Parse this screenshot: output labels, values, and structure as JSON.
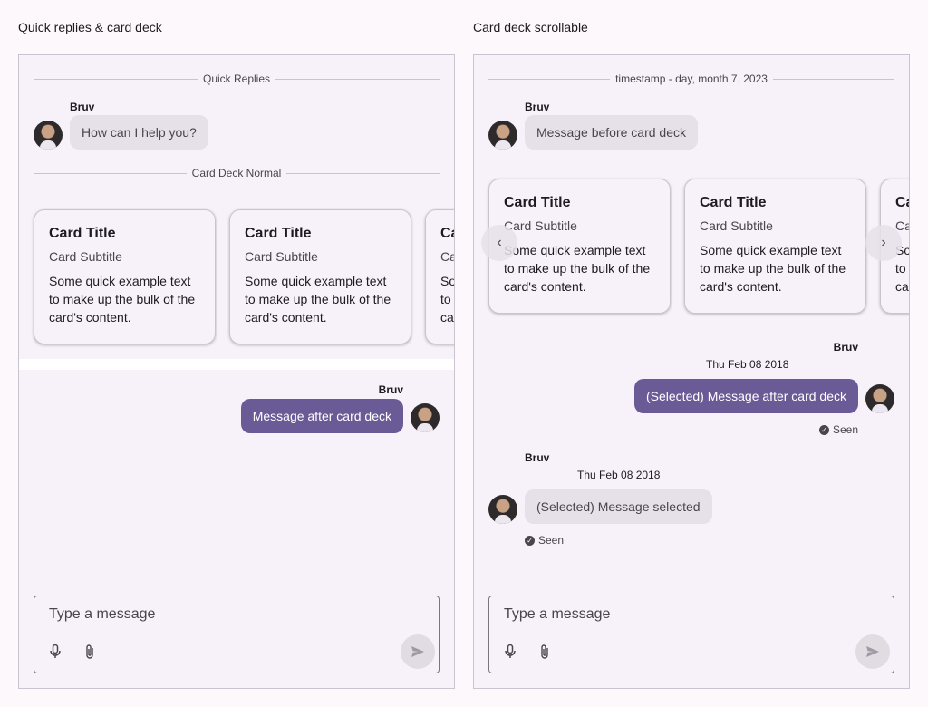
{
  "left": {
    "label": "Quick replies & card deck",
    "divider_top": "Quick Replies",
    "msg1": {
      "sender": "Bruv",
      "text": "How can I help you?"
    },
    "divider_cards": "Card Deck Normal",
    "cards": [
      {
        "title": "Card Title",
        "subtitle": "Card Subtitle",
        "text": "Some quick example text to make up the bulk of the card's content."
      },
      {
        "title": "Card Title",
        "subtitle": "Card Subtitle",
        "text": "Some quick example text to make up the bulk of the card's content."
      },
      {
        "title": "Card Title",
        "subtitle": "Card Subtitle",
        "text": "Some quick example text to make up the bulk of the card's content."
      }
    ],
    "msg2": {
      "sender": "Bruv",
      "text": "Message after card deck"
    },
    "composer": {
      "placeholder": "Type a message"
    }
  },
  "right": {
    "label": "Card deck scrollable",
    "divider_top": "timestamp - day, month 7, 2023",
    "msg1": {
      "sender": "Bruv",
      "text": "Message before card deck"
    },
    "cards": [
      {
        "title": "Card Title",
        "subtitle": "Card Subtitle",
        "text": "Some quick example text to make up the bulk of the card's content."
      },
      {
        "title": "Card Title",
        "subtitle": "Card Subtitle",
        "text": "Some quick example text to make up the bulk of the card's content."
      },
      {
        "title": "Card Title",
        "subtitle": "Card Subtitle",
        "text": "Some quick example text to make up the bulk of the card's content."
      }
    ],
    "nav": {
      "prev_icon": "chevron-left-icon",
      "next_icon": "chevron-right-icon"
    },
    "msg2": {
      "sender": "Bruv",
      "timestamp": "Thu Feb 08 2018",
      "text": "(Selected) Message after card deck",
      "status": "Seen"
    },
    "msg3": {
      "sender": "Bruv",
      "timestamp": "Thu Feb 08 2018",
      "text": "(Selected) Message selected",
      "status": "Seen"
    },
    "composer": {
      "placeholder": "Type a message"
    }
  },
  "icons": {
    "mic": "mic-icon",
    "attach": "paperclip-icon",
    "send": "send-icon",
    "seen": "check-circle-icon"
  },
  "colors": {
    "background": "#fdf8fc",
    "panel": "#f7f2f9",
    "incoming_bubble": "#e6e0e9",
    "outgoing_bubble": "#6a5a96",
    "border": "#cac4d0"
  }
}
